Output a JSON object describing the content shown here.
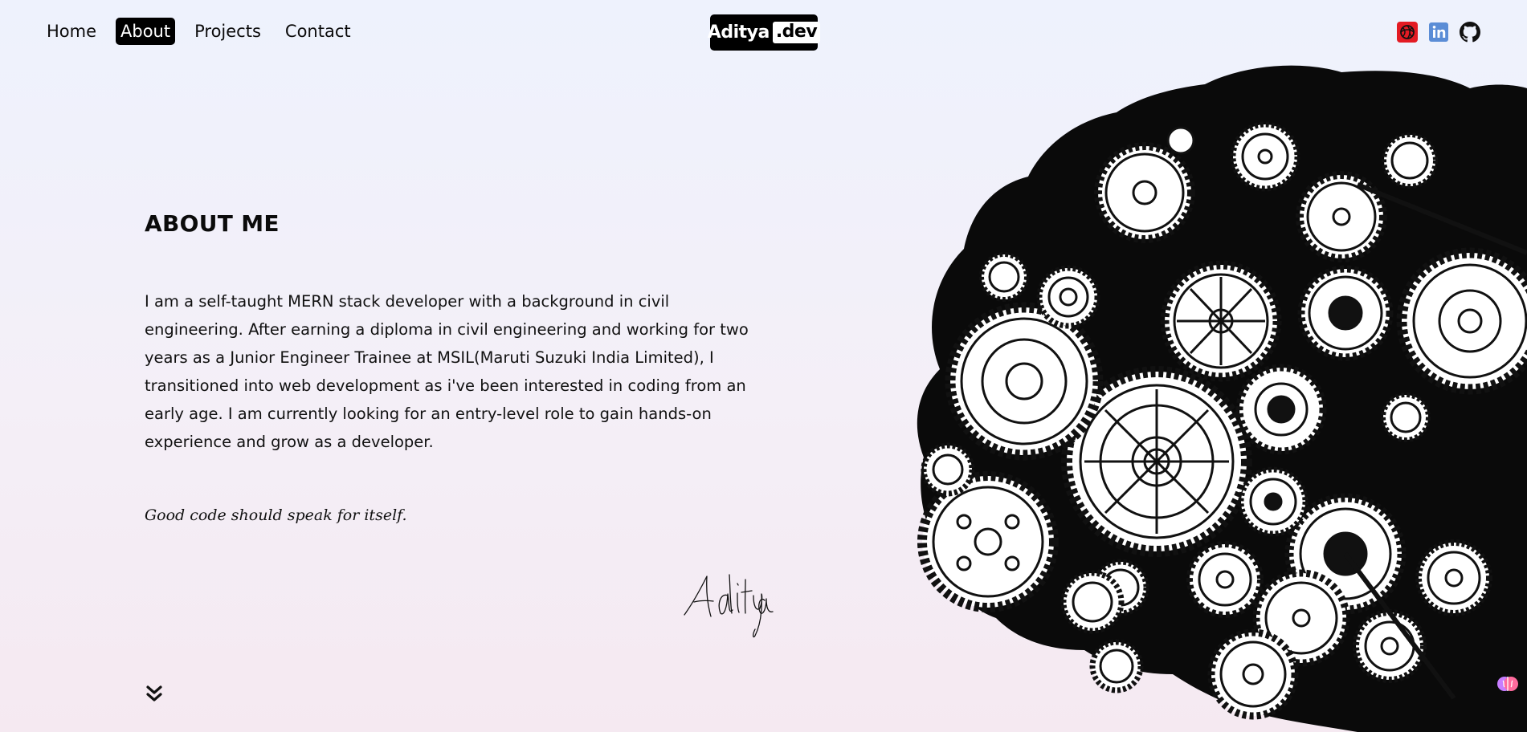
{
  "nav": {
    "items": [
      {
        "label": "Home",
        "active": false
      },
      {
        "label": "About",
        "active": true
      },
      {
        "label": "Projects",
        "active": false
      },
      {
        "label": "Contact",
        "active": false
      }
    ]
  },
  "logo": {
    "main": "Aditya",
    "suffix": ".dev"
  },
  "socials": [
    {
      "icon": "spiral-logo-icon",
      "color": "#e31b23"
    },
    {
      "icon": "linkedin-icon",
      "color": "#0a66c2"
    },
    {
      "icon": "github-icon",
      "color": "#000000"
    }
  ],
  "about": {
    "title": "ABOUT ME",
    "bio": "I am a self-taught MERN stack developer with a background in civil engineering. After earning a diploma in civil engineering and working for two years as a Junior Engineer Trainee at MSIL(Maruti Suzuki India Limited), I transitioned into web development as i've been interested in coding from an early age. I am currently looking for an entry-level role to gain hands-on experience and grow as a developer.",
    "quote": "Good code should speak for itself.",
    "signature": "Aditya"
  },
  "scroll_icon": "double-chevron-down-icon",
  "hero_art": "gear-brain-illustration",
  "corner_badge": "brain-icon"
}
